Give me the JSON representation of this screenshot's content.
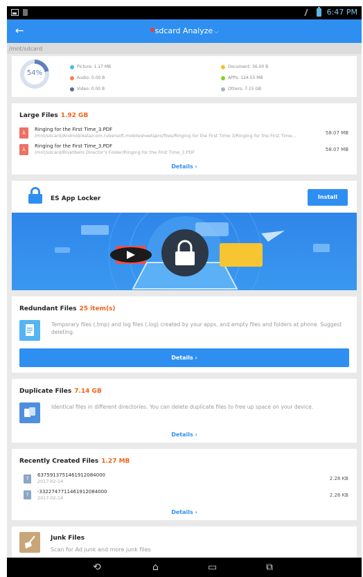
{
  "status_bar": {
    "time": "6:47 PM"
  },
  "app_bar": {
    "back_glyph": "←",
    "title": "sdcard Analyze",
    "caret": "⌵"
  },
  "path": "/mnt/sdcard",
  "storage": {
    "percent": "54%",
    "percent_value": 54,
    "items": [
      {
        "label": "Picture: 1.17 MB",
        "color": "#4fb7e8"
      },
      {
        "label": "Audio: 0.00 B",
        "color": "#ff7a59"
      },
      {
        "label": "Video: 0.00 B",
        "color": "#5b6b8c"
      },
      {
        "label": "Document: 36.00 B",
        "color": "#f7c11e"
      },
      {
        "label": "APPs: 124.55 MB",
        "color": "#7fd12b"
      },
      {
        "label": "Others: 7.15 GB",
        "color": "#a8b4c8"
      }
    ]
  },
  "large_files": {
    "title": "Large Files",
    "size": "1.92 GB",
    "files": [
      {
        "name": "Ringing for the First Time_3.PDF",
        "path": "/mnt/sdcard/Android/data/com.rubersoft.mobilesheetspro/files/Ringing for the First Time 3/Ringing for the First Time...",
        "size": "58.07 MB"
      },
      {
        "name": "Ringing for the First Time_3.PDF",
        "path": "/mnt/sdcard/Rivetbells Director's Folder/Ringing for the First Time_3.PDF",
        "size": "58.07 MB"
      }
    ],
    "details": "Details  ›"
  },
  "locker": {
    "title": "ES App Locker",
    "install": "Install"
  },
  "redundant": {
    "title": "Redundant Files",
    "count": "25 item(s)",
    "desc": "Temporary files (.tmp) and log files (.log) created by your apps, and empty files and folders at phone. Suggest deleting.",
    "details": "Details  ›"
  },
  "duplicate": {
    "title": "Duplicate Files",
    "size": "7.14 GB",
    "desc": "Identical files in different directories. You can delete duplicate files to free up space on your device.",
    "details": "Details  ›"
  },
  "recent": {
    "title": "Recently Created Files",
    "size": "1.27 MB",
    "files": [
      {
        "name": "6375913751461912084000",
        "date": "2017-02-14",
        "size": "2.28 KB"
      },
      {
        "name": "-3322747711461912084000",
        "date": "2017-02-14",
        "size": "2.28 KB"
      }
    ],
    "details": "Details  ›"
  },
  "junk": {
    "title": "Junk Files",
    "desc": "Scan for Ad junk and more junk files"
  },
  "nav": {
    "back": "⟲",
    "home": "⌂",
    "recents": "▭",
    "screenshot": "⧉"
  }
}
